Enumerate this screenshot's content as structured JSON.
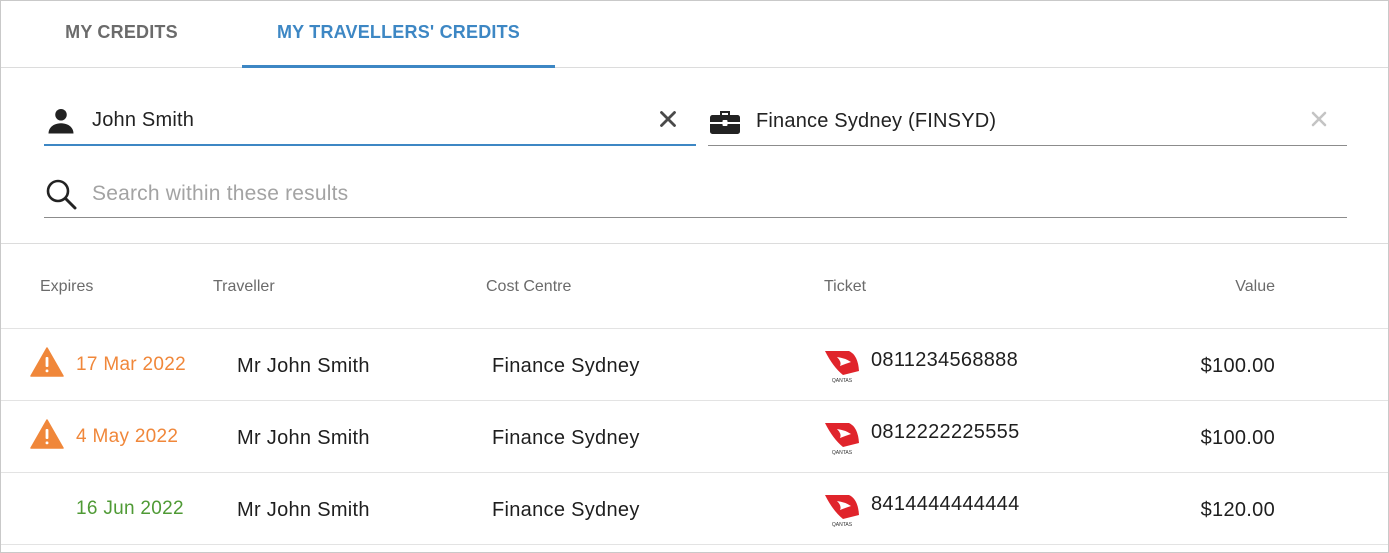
{
  "tabs": [
    {
      "label": "MY CREDITS",
      "active": false
    },
    {
      "label": "MY TRAVELLERS' CREDITS",
      "active": true
    }
  ],
  "filters": {
    "traveller": {
      "value": "John Smith",
      "icon": "person-icon",
      "clear_icon": "close-icon"
    },
    "cost_centre": {
      "value": "Finance Sydney (FINSYD)",
      "icon": "briefcase-icon",
      "clear_icon": "close-icon"
    },
    "search": {
      "placeholder": "Search within these results",
      "value": "",
      "icon": "search-icon"
    }
  },
  "table": {
    "headers": {
      "expires": "Expires",
      "traveller": "Traveller",
      "cost_centre": "Cost Centre",
      "ticket": "Ticket",
      "value": "Value"
    },
    "rows": [
      {
        "expires": "17 Mar 2022",
        "warning": true,
        "status_color": "#f0873a",
        "traveller": "Mr John Smith",
        "cost_centre": "Finance Sydney",
        "airline_icon": "qantas-logo-icon",
        "ticket": "0811234568888",
        "value": "$100.00"
      },
      {
        "expires": "4 May 2022",
        "warning": true,
        "status_color": "#f0873a",
        "traveller": "Mr John Smith",
        "cost_centre": "Finance Sydney",
        "airline_icon": "qantas-logo-icon",
        "ticket": "0812222225555",
        "value": "$100.00"
      },
      {
        "expires": "16 Jun 2022",
        "warning": false,
        "status_color": "#4f9a35",
        "traveller": "Mr John Smith",
        "cost_centre": "Finance Sydney",
        "airline_icon": "qantas-logo-icon",
        "ticket": "8414444444444",
        "value": "$120.00"
      }
    ]
  },
  "colors": {
    "accent": "#3d87c4",
    "warning": "#f0873a",
    "valid": "#4f9a35",
    "airline_red": "#e0242b"
  }
}
